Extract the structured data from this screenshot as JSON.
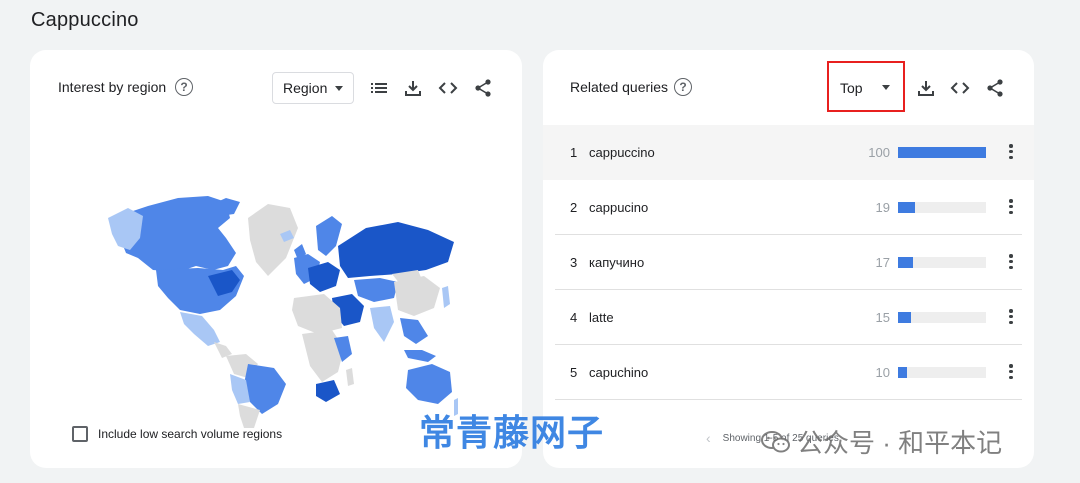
{
  "page": {
    "title": "Cappuccino"
  },
  "interest_by_region": {
    "title": "Interest by region",
    "select_value": "Region",
    "checkbox_label": "Include low search volume regions"
  },
  "related_queries": {
    "title": "Related queries",
    "select_value": "Top",
    "rows": [
      {
        "rank": "1",
        "query": "cappuccino",
        "value": "100",
        "bar": 100
      },
      {
        "rank": "2",
        "query": "cappucino",
        "value": "19",
        "bar": 19
      },
      {
        "rank": "3",
        "query": "капучино",
        "value": "17",
        "bar": 17
      },
      {
        "rank": "4",
        "query": "latte",
        "value": "15",
        "bar": 15
      },
      {
        "rank": "5",
        "query": "capuchino",
        "value": "10",
        "bar": 10
      }
    ],
    "pager_text": "Showing 1-5 of 25 queries"
  },
  "icons": {
    "help": "help-circle-icon",
    "list": "list-icon",
    "download": "download-icon",
    "embed": "code-icon",
    "share": "share-icon",
    "more": "more-vertical-icon"
  },
  "watermarks": {
    "blue_text": "常青藤网子",
    "gray_text": "公众号 · 和平本记"
  },
  "colors": {
    "bar": "#3e7be0",
    "highlight": "#e8201f",
    "map_dark": "#1a56c8",
    "map_mid": "#4f86e8",
    "map_light": "#a9c7f5",
    "map_none": "#dcdcdc"
  }
}
